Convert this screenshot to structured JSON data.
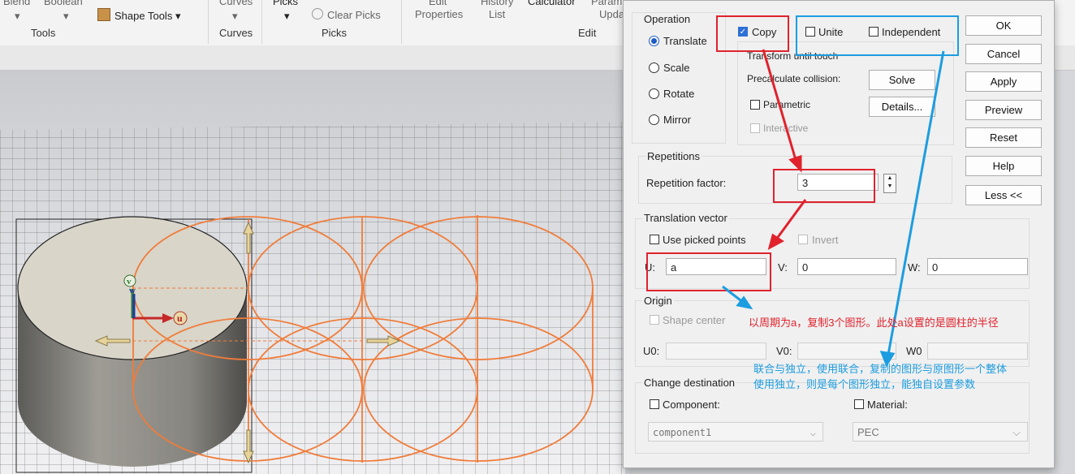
{
  "ribbon": {
    "top_cut": [
      "Blend",
      "Boolean",
      "Curves",
      "Picks",
      "Edit",
      "History",
      "Calculator",
      "Param"
    ],
    "shape_tools": "Shape Tools",
    "dropdown_arrow": "▾",
    "clear_picks": "Clear Picks",
    "edit_properties": "Properties",
    "history_list": "List",
    "update": "Upda",
    "groups": {
      "tools": "Tools",
      "curves": "Curves",
      "picks": "Picks",
      "edit": "Edit"
    }
  },
  "viewport": {
    "axis_labels": {
      "u": "u",
      "v": "v",
      "w": "w"
    },
    "colors": {
      "cylinder_top": "#d8d4c8",
      "cylinder_side": "#8a8a86",
      "wire": "#f07c3a",
      "grid": "#5a5a5a"
    }
  },
  "dialog": {
    "operation": {
      "title": "Operation",
      "options": [
        "Translate",
        "Scale",
        "Rotate",
        "Mirror"
      ],
      "selected": "Translate"
    },
    "copy": "Copy",
    "unite": "Unite",
    "independent": "Independent",
    "transform_until_touch": "Transform until touch",
    "precalc": "Precalculate collision:",
    "solve": "Solve",
    "parametric": "Parametric",
    "details": "Details...",
    "interactive": "Interactive",
    "buttons": [
      "OK",
      "Cancel",
      "Apply",
      "Preview",
      "Reset",
      "Help",
      "Less <<"
    ],
    "repetitions": {
      "title": "Repetitions",
      "label": "Repetition factor:",
      "value": "3"
    },
    "translation": {
      "title": "Translation vector",
      "use_picked": "Use picked points",
      "invert": "Invert",
      "u_label": "U:",
      "u_value": "a",
      "v_label": "V:",
      "v_value": "0",
      "w_label": "W:",
      "w_value": "0"
    },
    "origin": {
      "title": "Origin",
      "shape_center": "Shape center",
      "u0": "U0:",
      "v0": "V0:",
      "w0": "W0"
    },
    "change_destination": {
      "title": "Change destination",
      "component": "Component:",
      "component_value": "component1",
      "material": "Material:",
      "material_value": "PEC"
    }
  },
  "annotations": {
    "red_note": "以周期为a，复制3个图形。此处a设置的是圆柱的半径",
    "blue_note_1": "联合与独立，使用联合，复制的图形与原图形一个整体",
    "blue_note_2": "使用独立，则是每个图形独立，能独自设置参数",
    "red_color": "#e0222d",
    "blue_color": "#1c9de0"
  }
}
